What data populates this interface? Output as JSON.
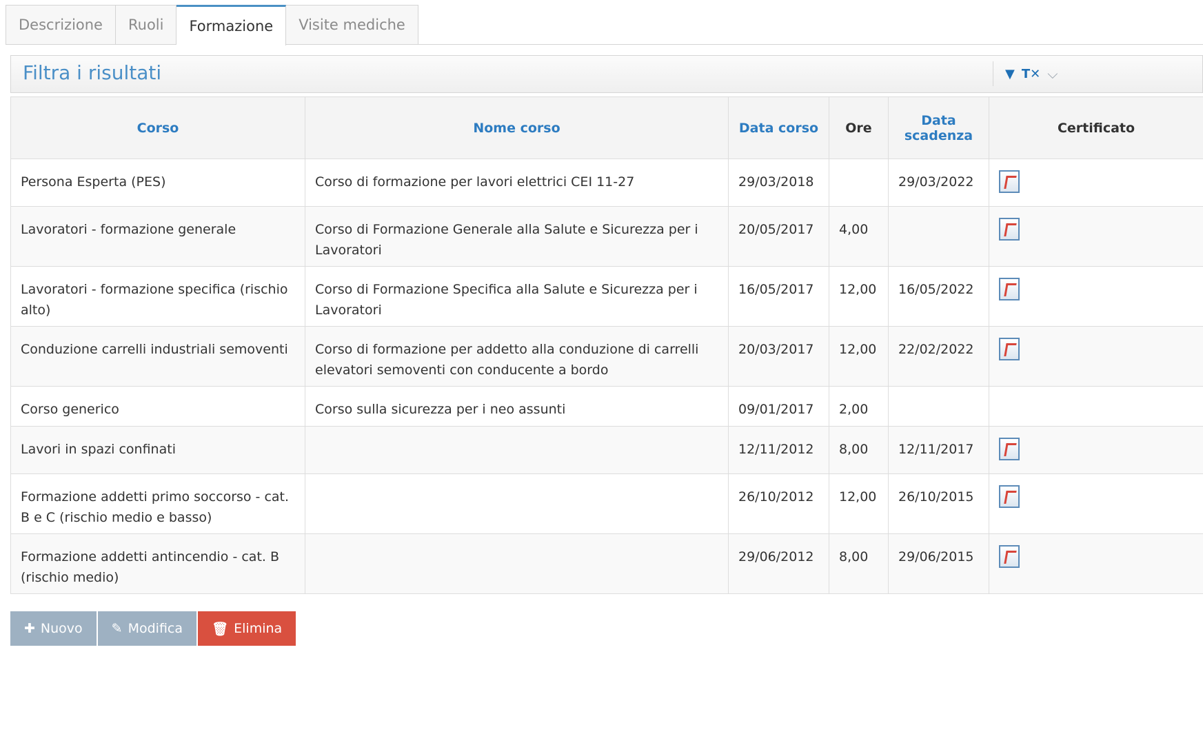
{
  "tabs": [
    {
      "label": "Descrizione"
    },
    {
      "label": "Ruoli"
    },
    {
      "label": "Formazione"
    },
    {
      "label": "Visite mediche"
    }
  ],
  "filter": {
    "title": "Filtra i risultati",
    "icons": [
      "filter-icon",
      "clear-filter-icon",
      "chevron-down-icon"
    ]
  },
  "table": {
    "headers": {
      "corso": "Corso",
      "nome_corso": "Nome corso",
      "data_corso": "Data corso",
      "ore": "Ore",
      "data_scadenza": "Data scadenza",
      "certificato": "Certificato"
    },
    "rows": [
      {
        "corso": "Persona Esperta (PES)",
        "nome": "Corso di formazione per lavori elettrici CEI 11-27",
        "data": "29/03/2018",
        "ore": "",
        "scadenza": "29/03/2022",
        "cert": true
      },
      {
        "corso": "Lavoratori - formazione generale",
        "nome": "Corso di Formazione Generale alla Salute e Sicurezza per i Lavoratori",
        "data": "20/05/2017",
        "ore": "4,00",
        "scadenza": "",
        "cert": true
      },
      {
        "corso": "Lavoratori - formazione specifica (rischio alto)",
        "nome": "Corso di Formazione Specifica alla Salute e Sicurezza per i Lavoratori",
        "data": "16/05/2017",
        "ore": "12,00",
        "scadenza": "16/05/2022",
        "cert": true
      },
      {
        "corso": "Conduzione carrelli industriali semoventi",
        "nome": "Corso di formazione per addetto alla conduzione di carrelli elevatori semoventi con conducente a bordo",
        "data": "20/03/2017",
        "ore": "12,00",
        "scadenza": "22/02/2022",
        "cert": true
      },
      {
        "corso": "Corso generico",
        "nome": "Corso sulla sicurezza per i neo assunti",
        "data": "09/01/2017",
        "ore": "2,00",
        "scadenza": "",
        "cert": false
      },
      {
        "corso": "Lavori in spazi confinati",
        "nome": "",
        "data": "12/11/2012",
        "ore": "8,00",
        "scadenza": "12/11/2017",
        "cert": true
      },
      {
        "corso": "Formazione addetti primo soccorso - cat. B e C (rischio medio e basso)",
        "nome": "",
        "data": "26/10/2012",
        "ore": "12,00",
        "scadenza": "26/10/2015",
        "cert": true
      },
      {
        "corso": "Formazione addetti antincendio - cat. B (rischio medio)",
        "nome": "",
        "data": "29/06/2012",
        "ore": "8,00",
        "scadenza": "29/06/2015",
        "cert": true
      }
    ]
  },
  "buttons": {
    "nuovo": "Nuovo",
    "modifica": "Modifica",
    "elimina": "Elimina"
  },
  "colors": {
    "accent": "#2d7cc1",
    "danger": "#d9503f",
    "disabled": "#9eb1c2"
  }
}
